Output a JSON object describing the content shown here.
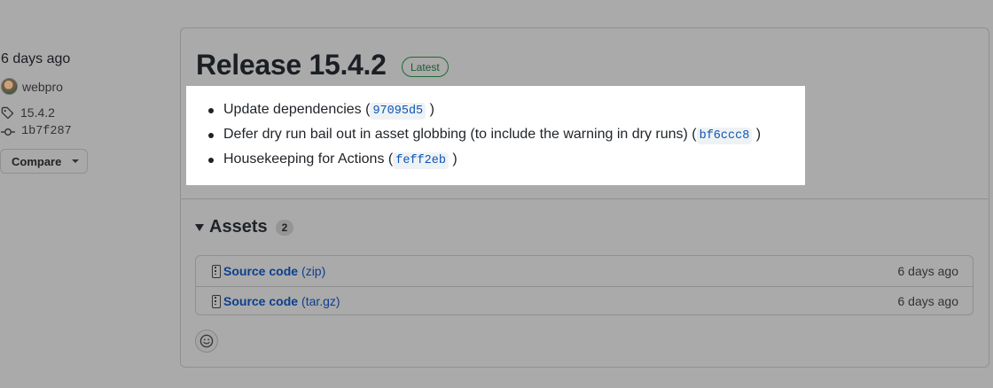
{
  "sidebar": {
    "date": "6 days ago",
    "author": "webpro",
    "tag": "15.4.2",
    "commit": "1b7f287",
    "compare_label": "Compare"
  },
  "release": {
    "title": "Release 15.4.2",
    "badge": "Latest",
    "notes": [
      {
        "text": "Update dependencies (",
        "sha": "97095d5",
        "close": ")"
      },
      {
        "text": "Defer dry run bail out in asset globbing (to include the warning in dry runs) (",
        "sha": "bf6ccc8",
        "close": ")"
      },
      {
        "text": "Housekeeping for Actions (",
        "sha": "feff2eb",
        "close": ")"
      }
    ]
  },
  "assets": {
    "title": "Assets",
    "count": "2",
    "items": [
      {
        "name": "Source code",
        "ext": "(zip)",
        "date": "6 days ago"
      },
      {
        "name": "Source code",
        "ext": "(tar.gz)",
        "date": "6 days ago"
      }
    ]
  },
  "colors": {
    "link": "#0a3f8f",
    "badge_green": "#1e6b35",
    "overlay_bg": "#aaaaaa"
  },
  "icons": [
    "tag-icon",
    "commit-icon",
    "zip-icon",
    "smiley-icon",
    "triangle-down-icon"
  ]
}
